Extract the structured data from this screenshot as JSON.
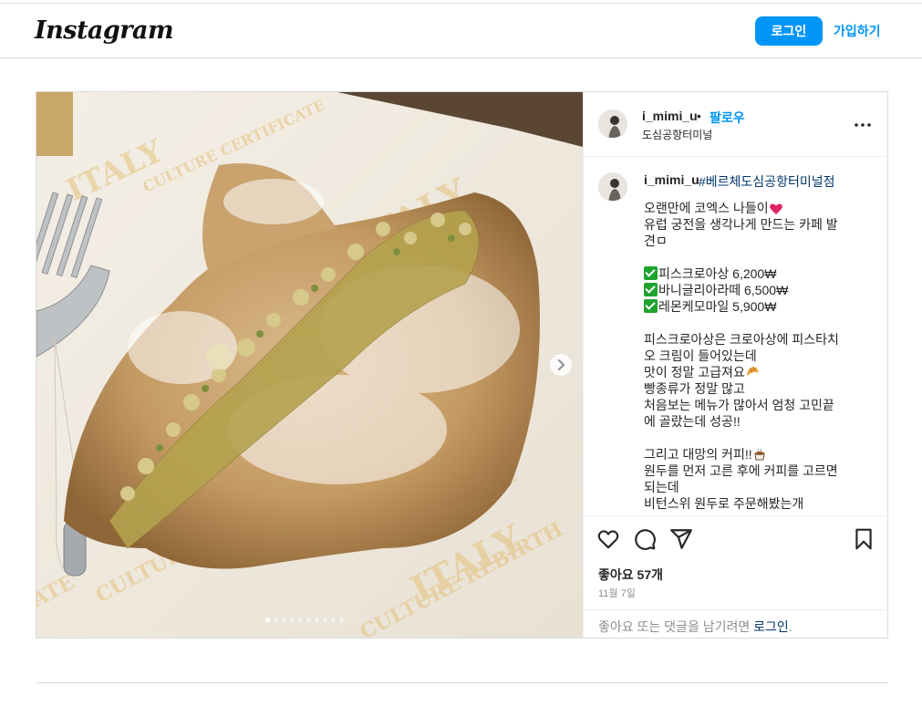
{
  "header": {
    "logo": "Instagram",
    "login_label": "로그인",
    "signup_label": "가입하기"
  },
  "post": {
    "username": "i_mimi_u",
    "dot": "•",
    "follow_label": "팔로우",
    "location": "도심공항터미널",
    "media": {
      "image_alt": "pistachio croissant with powdered sugar on printed paper",
      "carousel_count": 10,
      "carousel_active": 1
    },
    "caption": {
      "username": "i_mimi_u",
      "hashtag": "#베르체도심공항터미널점",
      "lines": {
        "l1": "오랜만에 코엑스 나들이",
        "l2": "유럽 궁전을 생각나게 만드는 카페 발",
        "l3": "견ㅁ",
        "m1": "피스크로아상 6,200₩",
        "m2": "바니글리아라떼 6,500₩",
        "m3": "레몬케모마일 5,900₩",
        "p1": "피스크로아상은 크로아상에 피스타치",
        "p2": "오 크림이 들어있는데",
        "p3": "맛이 정말 고급져요",
        "p4": "빵종류가 정말 많고",
        "p5": "처음보는 메뉴가 많아서 엄청 고민끝",
        "p6": "에 골랐는데 성공!!",
        "q1": "그리고 대망의 커피!!",
        "q2": "원두를 먼저 고른 후에 커피를 고르면",
        "q3": "되는데",
        "q4": "비턴스위 원두로 주문해봤는개"
      }
    },
    "likes": "좋아요 57개",
    "date": "11월 7일",
    "comment_prompt_pre": "좋아요 또는 댓글을 남기려면 ",
    "comment_prompt_link": "로그인",
    "comment_prompt_post": ".",
    "colors": {
      "accent": "#0095f6",
      "link_dark": "#00376b",
      "heart_red": "#e0245e",
      "check_green": "#1fa32f"
    },
    "icons": [
      "heart-icon",
      "comment-icon",
      "share-icon",
      "bookmark-icon",
      "more-icon",
      "chevron-right-icon"
    ]
  }
}
